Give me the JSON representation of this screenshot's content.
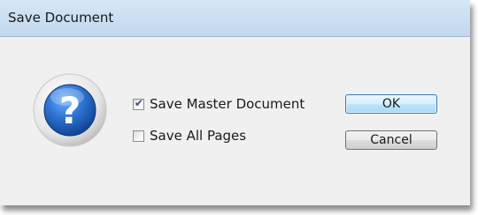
{
  "dialog": {
    "title": "Save Document",
    "icon": "question-help-icon",
    "options": [
      {
        "label": "Save Master Document",
        "checked": true
      },
      {
        "label": "Save All Pages",
        "checked": false
      }
    ],
    "buttons": {
      "ok_label": "OK",
      "cancel_label": "Cancel"
    }
  },
  "colors": {
    "titlebar": "#c8dcf0",
    "body": "#f0f0f0",
    "icon_blue": "#1f5fb8",
    "default_button_border": "#3c7fb1"
  }
}
